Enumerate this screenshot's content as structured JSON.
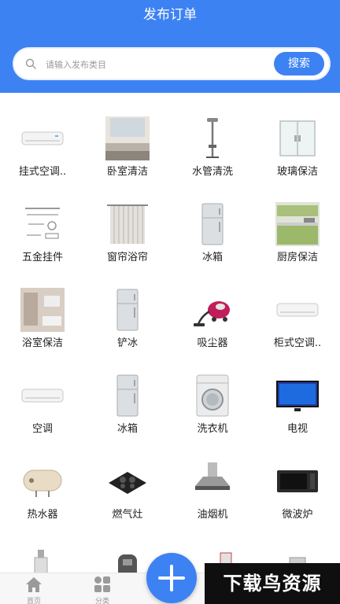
{
  "header": {
    "title": "发布订单"
  },
  "search": {
    "placeholder": "请输入发布类目",
    "button_label": "搜索"
  },
  "categories": [
    {
      "label": "挂式空调..",
      "icon": "wall-ac-icon"
    },
    {
      "label": "卧室清洁",
      "icon": "bedroom-cleaning-icon"
    },
    {
      "label": "水管清洗",
      "icon": "water-pipe-icon"
    },
    {
      "label": "玻璃保洁",
      "icon": "glass-cleaning-icon"
    },
    {
      "label": "五金挂件",
      "icon": "hardware-rack-icon"
    },
    {
      "label": "窗帘浴帘",
      "icon": "curtain-icon"
    },
    {
      "label": "冰箱",
      "icon": "fridge-icon"
    },
    {
      "label": "厨房保洁",
      "icon": "kitchen-cleaning-icon"
    },
    {
      "label": "浴室保洁",
      "icon": "bathroom-cleaning-icon"
    },
    {
      "label": "铲冰",
      "icon": "fridge-icon"
    },
    {
      "label": "吸尘器",
      "icon": "vacuum-icon"
    },
    {
      "label": "柜式空调..",
      "icon": "cabinet-ac-icon"
    },
    {
      "label": "空调",
      "icon": "ac-icon"
    },
    {
      "label": "冰箱",
      "icon": "fridge-icon"
    },
    {
      "label": "洗衣机",
      "icon": "washing-machine-icon"
    },
    {
      "label": "电视",
      "icon": "tv-icon"
    },
    {
      "label": "热水器",
      "icon": "water-heater-icon"
    },
    {
      "label": "燃气灶",
      "icon": "gas-stove-icon"
    },
    {
      "label": "油烟机",
      "icon": "range-hood-icon"
    },
    {
      "label": "微波炉",
      "icon": "microwave-icon"
    }
  ],
  "nav": {
    "home_label": "首页",
    "category_label": "分类"
  },
  "watermark": "下载鸟资源",
  "colors": {
    "accent": "#3d82f3"
  }
}
